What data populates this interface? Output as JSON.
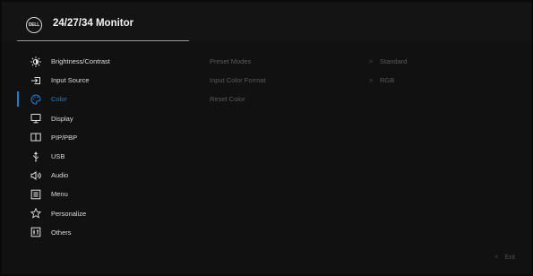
{
  "header": {
    "logo_text": "DELL",
    "title": "24/27/34 Monitor"
  },
  "menu": {
    "items": [
      {
        "label": "Brightness/Contrast",
        "icon": "sun-icon"
      },
      {
        "label": "Input Source",
        "icon": "input-source-icon"
      },
      {
        "label": "Color",
        "icon": "color-palette-icon",
        "active": true
      },
      {
        "label": "Display",
        "icon": "display-icon"
      },
      {
        "label": "PIP/PBP",
        "icon": "pip-pbp-icon"
      },
      {
        "label": "USB",
        "icon": "usb-icon"
      },
      {
        "label": "Audio",
        "icon": "speaker-icon"
      },
      {
        "label": "Menu",
        "icon": "menu-icon"
      },
      {
        "label": "Personalize",
        "icon": "star-icon"
      },
      {
        "label": "Others",
        "icon": "others-icon"
      }
    ]
  },
  "submenu": {
    "rows": [
      {
        "label": "Preset Modes",
        "chevron": ">",
        "value": "Standard"
      },
      {
        "label": "Input Color Format",
        "chevron": ">",
        "value": "RGB"
      },
      {
        "label": "Reset Color",
        "chevron": "",
        "value": ""
      }
    ]
  },
  "footer": {
    "chevron": "<",
    "exit_label": "Exit"
  },
  "colors": {
    "accent": "#1f7fd1",
    "background": "#111111",
    "text": "#dcdcdc",
    "disabled_text": "#5a5a5a"
  }
}
